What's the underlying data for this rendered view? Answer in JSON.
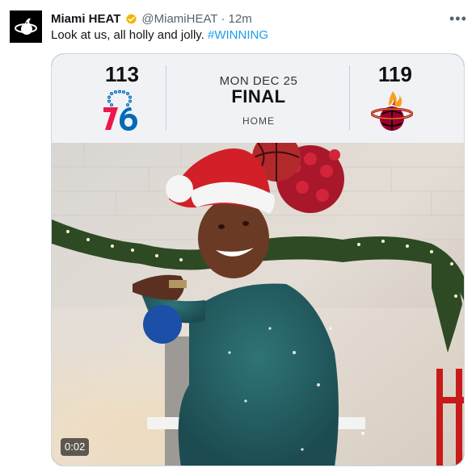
{
  "tweet": {
    "display_name": "Miami HEAT",
    "handle": "@MiamiHEAT",
    "separator": "·",
    "time": "12m",
    "text": "Look at us, all holly and jolly.",
    "hashtag": "#WINNING",
    "more_icon": "more-icon",
    "verified_icon": "verified-badge-icon",
    "avatar_icon": "miami-heat-avatar-icon"
  },
  "scoreboard": {
    "away": {
      "score": "113",
      "logo_icon": "philadelphia-76ers-logo-icon"
    },
    "home": {
      "score": "119",
      "logo_icon": "miami-heat-logo-icon"
    },
    "date": "MON DEC 25",
    "status": "FINAL",
    "venue": "HOME"
  },
  "video": {
    "timestamp": "0:02"
  },
  "colors": {
    "hashtag": "#1d9bf0",
    "verified": "#f5b400",
    "heat_red": "#98002e",
    "sixers_red": "#ed174c",
    "sixers_blue": "#006bb6",
    "scoreboard_bg": "#f0f2f5"
  }
}
